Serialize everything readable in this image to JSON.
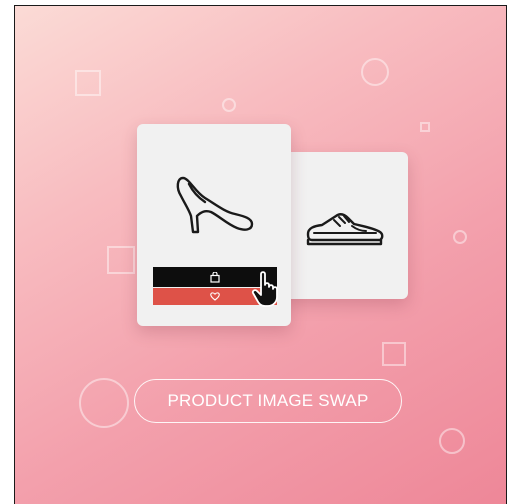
{
  "banner": {
    "title": "PRODUCT IMAGE SWAP"
  },
  "cards": {
    "front_icon": "high-heel-shoe-icon",
    "back_icon": "sneaker-icon"
  },
  "actions": {
    "cart_icon": "shopping-bag-icon",
    "wishlist_icon": "heart-icon",
    "cursor_icon": "pointer-hand-icon"
  },
  "colors": {
    "cart_bar": "#0d0d0d",
    "wishlist_bar": "#de5248",
    "card_bg": "#f1f1f1"
  }
}
